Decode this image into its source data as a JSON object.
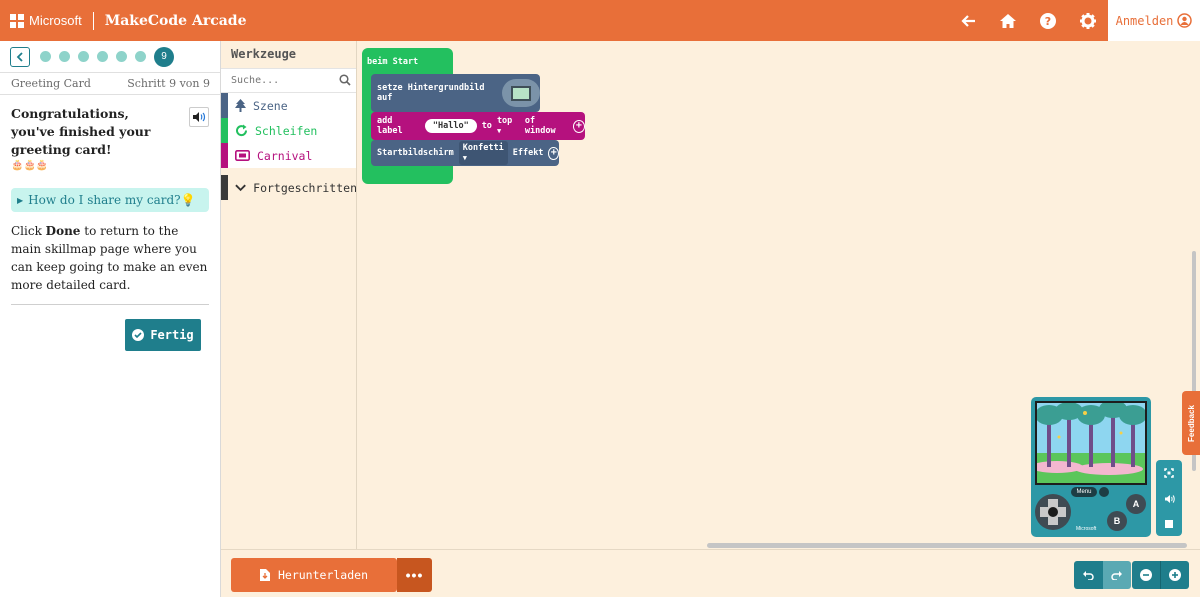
{
  "header": {
    "brand": "Microsoft",
    "app_title": "MakeCode Arcade",
    "sign_in": "Anmelden",
    "icons": [
      "back-arrow-icon",
      "home-icon",
      "help-icon",
      "settings-icon"
    ],
    "accent_color": "#e86f39"
  },
  "tutorial": {
    "current_step": "9",
    "title": "Greeting Card",
    "step_label": "Schritt 9 von 9",
    "heading": "Congratulations, you've finished your greeting card!",
    "emojis": "🎂🎂🎂",
    "hint": "How do I share my card?💡",
    "body_pre": "Click ",
    "body_bold": "Done",
    "body_post": " to return to the main skillmap page where you can keep going to make an even more detailed card.",
    "done_label": "Fertig"
  },
  "toolbox": {
    "title": "Werkzeuge",
    "search_placeholder": "Suche...",
    "categories": [
      {
        "label": "Szene",
        "color": "#4b6485"
      },
      {
        "label": "Schleifen",
        "color": "#23c05f"
      },
      {
        "label": "Carnival",
        "color": "#b5117e"
      }
    ],
    "advanced": "Fortgeschritten"
  },
  "blocks": {
    "on_start": "beim Start",
    "set_bg": "setze Hintergrundbild auf",
    "add_label": "add label",
    "label_text": "Hallo",
    "to": "to",
    "position": "top",
    "of_window": "of window",
    "splash": "Startbildschirm",
    "effect": "Konfetti",
    "effect_suffix": "Effekt"
  },
  "simulator": {
    "menu": "Menu",
    "button_a": "A",
    "button_b": "B",
    "brand": "Microsoft",
    "feedback": "Feedback"
  },
  "bottombar": {
    "download": "Herunterladen",
    "more": "•••"
  }
}
